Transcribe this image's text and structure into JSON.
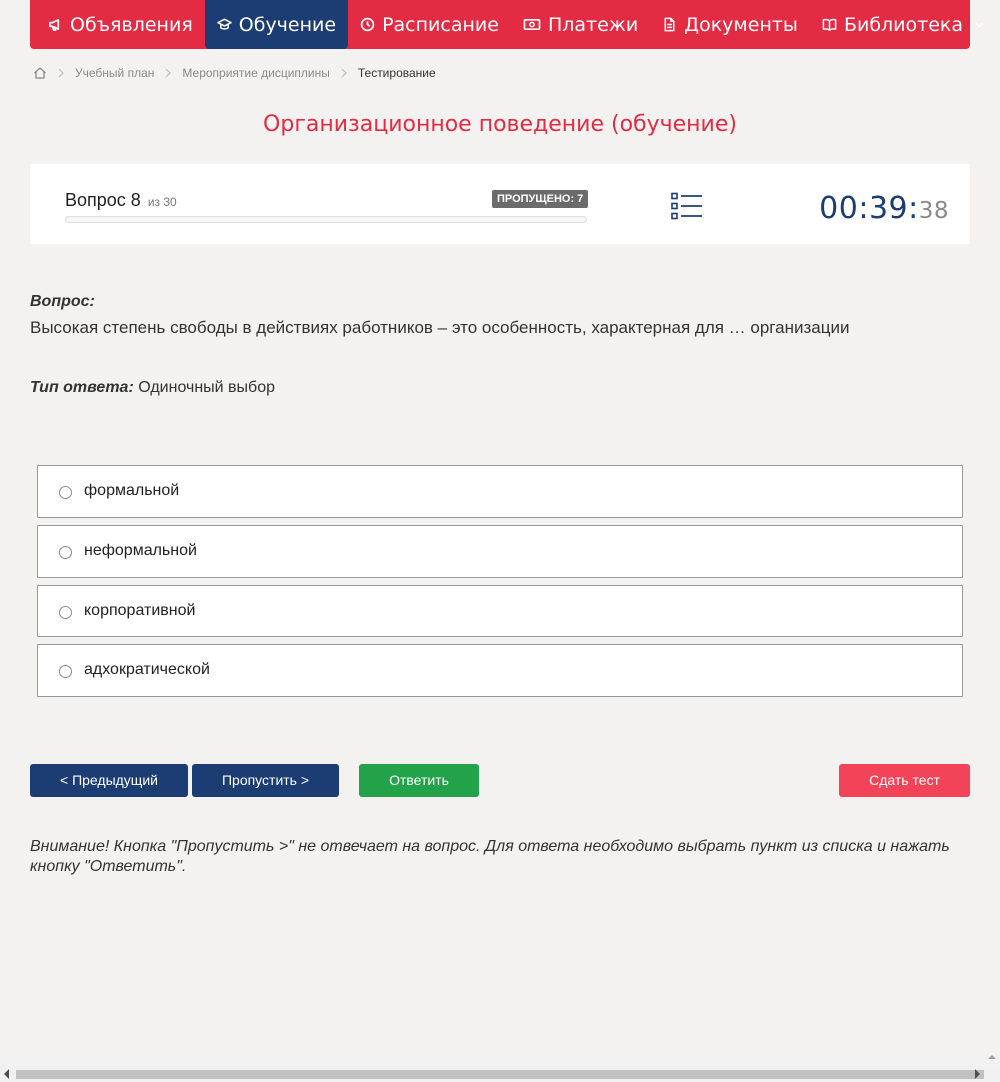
{
  "nav": {
    "items": [
      {
        "label": "Объявления",
        "icon": "megaphone-icon"
      },
      {
        "label": "Обучение",
        "icon": "graduation-cap-icon",
        "active": true
      },
      {
        "label": "Расписание",
        "icon": "clock-icon"
      },
      {
        "label": "Платежи",
        "icon": "money-icon"
      },
      {
        "label": "Документы",
        "icon": "document-icon"
      },
      {
        "label": "Библиотека",
        "icon": "book-icon",
        "dropdown": true
      }
    ]
  },
  "breadcrumb": {
    "home_icon": "home-icon",
    "items": [
      "Учебный план",
      "Мероприятие дисциплины",
      "Тестирование"
    ]
  },
  "page_title": "Организационное поведение (обучение)",
  "progress": {
    "question_label": "Вопрос 8",
    "total_label": "из 30",
    "skipped_label": "ПРОПУЩЕНО: 7",
    "fraction": 0
  },
  "timer": {
    "hm": "00:39:",
    "sec": "38"
  },
  "question": {
    "label": "Вопрос:",
    "text": "Высокая степень свободы в действиях работников – это особенность, характерная для … организации",
    "answer_type_label": "Тип ответа:",
    "answer_type": "Одиночный выбор"
  },
  "options": [
    "формальной",
    "неформальной",
    "корпоративной",
    "адхократической"
  ],
  "buttons": {
    "prev": "< Предыдущий",
    "skip": "Пропустить >",
    "answer": "Ответить",
    "submit": "Сдать тест"
  },
  "warning": "Внимание! Кнопка \"Пропустить >\" не отвечает на вопрос. Для ответа необходимо выбрать пункт из списка и нажать кнопку \"Ответить\".",
  "colors": {
    "accent_red": "#e32b43",
    "navy": "#1b3d73",
    "green": "#22a34a",
    "submit_red": "#f34359"
  }
}
